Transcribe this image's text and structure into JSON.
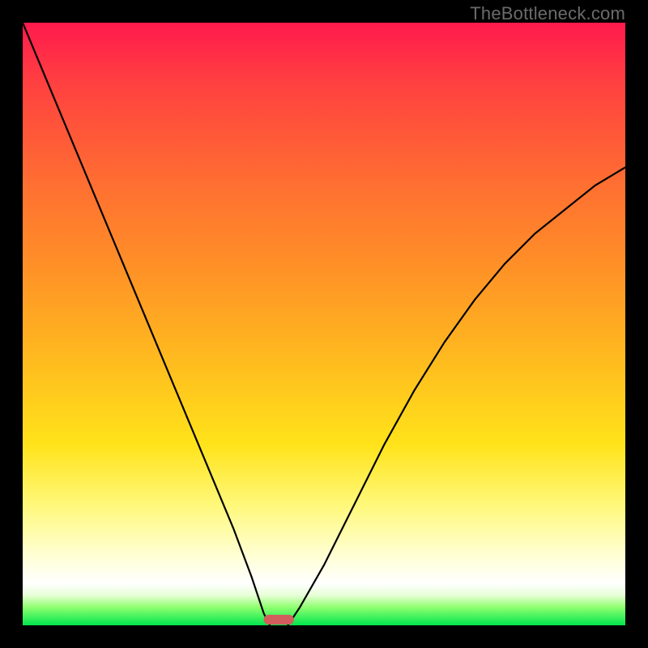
{
  "watermark": "TheBottleneck.com",
  "chart_data": {
    "type": "line",
    "title": "",
    "xlabel": "",
    "ylabel": "",
    "xlim": [
      0,
      100
    ],
    "ylim": [
      0,
      100
    ],
    "grid": false,
    "legend": false,
    "series": [
      {
        "name": "left-branch",
        "x": [
          0,
          5,
          10,
          15,
          20,
          25,
          30,
          35,
          38,
          40,
          41
        ],
        "y": [
          100,
          88,
          76,
          64,
          52,
          40,
          28,
          16,
          8,
          2,
          0
        ]
      },
      {
        "name": "right-branch",
        "x": [
          44,
          46,
          50,
          55,
          60,
          65,
          70,
          75,
          80,
          85,
          90,
          95,
          100
        ],
        "y": [
          0,
          3,
          10,
          20,
          30,
          39,
          47,
          54,
          60,
          65,
          69,
          73,
          76
        ]
      }
    ],
    "marker": {
      "name": "minimum-marker",
      "x": 42.5,
      "width": 5,
      "color": "#d25d5d"
    },
    "gradient_stops": [
      {
        "pos": 0,
        "color": "#ff1a4d"
      },
      {
        "pos": 10,
        "color": "#ff4040"
      },
      {
        "pos": 25,
        "color": "#ff6a33"
      },
      {
        "pos": 40,
        "color": "#ff8f27"
      },
      {
        "pos": 55,
        "color": "#ffb81f"
      },
      {
        "pos": 70,
        "color": "#ffe31a"
      },
      {
        "pos": 80,
        "color": "#fff87a"
      },
      {
        "pos": 88,
        "color": "#ffffd0"
      },
      {
        "pos": 93,
        "color": "#ffffff"
      },
      {
        "pos": 95,
        "color": "#e8ffd8"
      },
      {
        "pos": 97,
        "color": "#8fff70"
      },
      {
        "pos": 100,
        "color": "#00e64d"
      }
    ]
  }
}
